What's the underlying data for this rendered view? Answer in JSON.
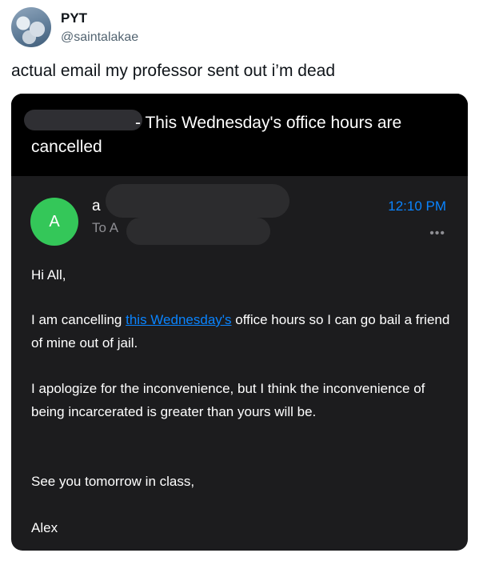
{
  "tweet": {
    "display_name": "PYT",
    "handle": "@saintalakae",
    "text": "actual email my professor sent out i’m dead"
  },
  "email": {
    "subject_suffix": "- This Wednesday's office hours are cancelled",
    "sender_initial": "A",
    "sender_name_visible": "a",
    "to_prefix": "To A",
    "time": "12:10 PM",
    "more_icon": "•••",
    "greeting": "Hi All,",
    "para1_before": "I am cancelling ",
    "para1_link": "this Wednesday's",
    "para1_after": " office hours so I can go bail a friend of mine out of jail.",
    "para2": "I apologize for the inconvenience, but I think the inconvenience of being incarcerated is greater than yours will be.",
    "signoff": "See you tomorrow in class,",
    "signature": "Alex"
  },
  "colors": {
    "link": "#0a84ff",
    "avatar_green": "#34c759",
    "card_bg": "#1c1c1e"
  }
}
